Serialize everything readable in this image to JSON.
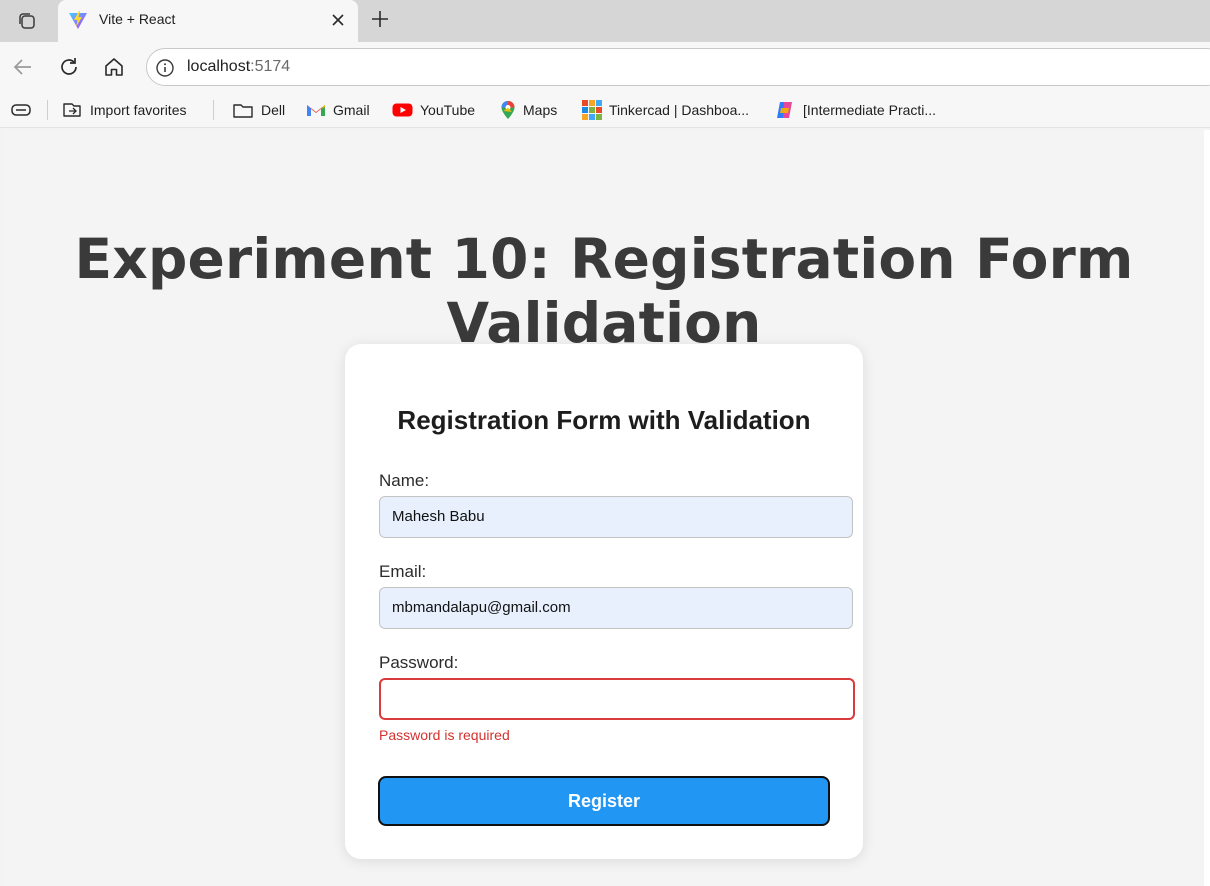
{
  "browser": {
    "tab": {
      "title": "Vite + React"
    },
    "address": {
      "host": "localhost",
      "port": ":5174"
    },
    "favorites": [
      {
        "label": "Import favorites",
        "icon": "import-favorites-icon"
      },
      {
        "label": "Dell",
        "icon": "folder-icon"
      },
      {
        "label": "Gmail",
        "icon": "gmail-icon"
      },
      {
        "label": "YouTube",
        "icon": "youtube-icon"
      },
      {
        "label": "Maps",
        "icon": "maps-pin-icon"
      },
      {
        "label": "Tinkercad | Dashboa...",
        "icon": "tinkercad-icon"
      },
      {
        "label": "[Intermediate Practi...",
        "icon": "copilot-icon"
      }
    ]
  },
  "page": {
    "heading": "Experiment 10: Registration Form Validation",
    "form": {
      "title": "Registration Form with Validation",
      "name_label": "Name:",
      "name_value": "Mahesh Babu",
      "email_label": "Email:",
      "email_value": "mbmandalapu@gmail.com",
      "password_label": "Password:",
      "password_value": "",
      "password_error": "Password is required",
      "submit_label": "Register"
    }
  },
  "colors": {
    "accent": "#2196f3",
    "error": "#d3322f",
    "autofill_bg": "#e8f0fe"
  }
}
